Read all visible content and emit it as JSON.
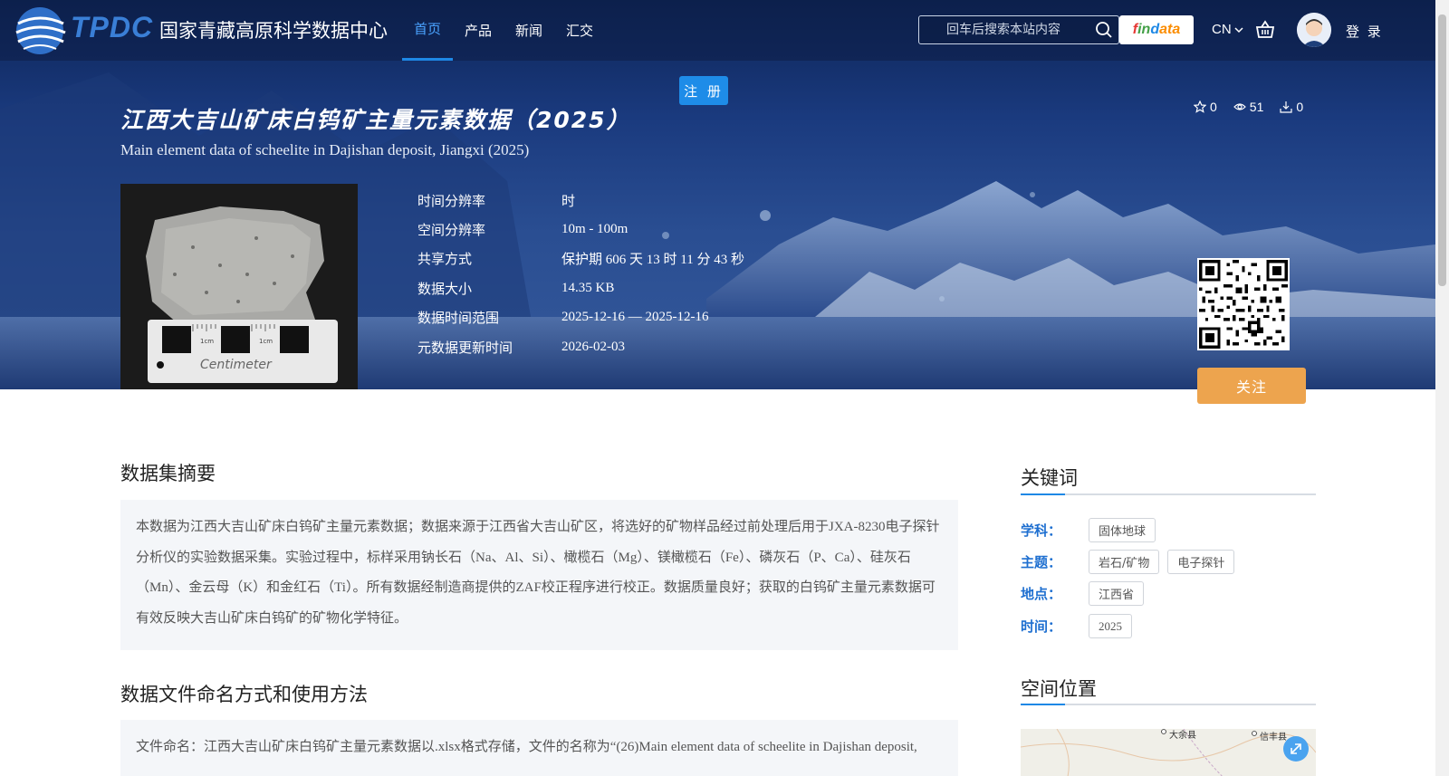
{
  "header": {
    "logo_text": "TPDC",
    "site_name": "国家青藏高原科学数据中心",
    "nav": [
      {
        "label": "首页",
        "active": true
      },
      {
        "label": "产品",
        "active": false
      },
      {
        "label": "新闻",
        "active": false
      },
      {
        "label": "汇交",
        "active": false
      }
    ],
    "search_placeholder": "回车后搜索本站内容",
    "findata_label": "findata",
    "language": "CN",
    "login_label": "登 录"
  },
  "register_label": "注 册",
  "dataset": {
    "title_cn": "江西大吉山矿床白钨矿主量元素数据（2025）",
    "title_en": "Main element data of scheelite in Dajishan deposit, Jiangxi (2025)",
    "stats": {
      "stars": "0",
      "views": "51",
      "downloads": "0"
    },
    "meta": [
      {
        "label": "时间分辨率",
        "value": "时"
      },
      {
        "label": "空间分辨率",
        "value": "10m - 100m"
      },
      {
        "label": "共享方式",
        "value": "保护期 606 天 13 时 11 分 43 秒"
      },
      {
        "label": "数据大小",
        "value": "14.35 KB"
      },
      {
        "label": "数据时间范围",
        "value": "2025-12-16 — 2025-12-16"
      },
      {
        "label": "元数据更新时间",
        "value": "2026-02-03"
      }
    ],
    "thumb_caption": "Centimeter",
    "thumb_tick_label": "1cm",
    "follow_label": "关注"
  },
  "abstract": {
    "title": "数据集摘要",
    "text": "本数据为江西大吉山矿床白钨矿主量元素数据；数据来源于江西省大吉山矿区，将选好的矿物样品经过前处理后用于JXA-8230电子探针分析仪的实验数据采集。实验过程中，标样采用钠长石（Na、Al、Si）、橄榄石（Mg）、镁橄榄石（Fe）、磷灰石（P、Ca）、硅灰石（Mn）、金云母（K）和金红石（Ti）。所有数据经制造商提供的ZAF校正程序进行校正。数据质量良好；获取的白钨矿主量元素数据可有效反映大吉山矿床白钨矿的矿物化学特征。"
  },
  "naming": {
    "title": "数据文件命名方式和使用方法",
    "text": "文件命名：江西大吉山矿床白钨矿主量元素数据以.xlsx格式存储，文件的名称为“(26)Main element data of scheelite in Dajishan deposit,"
  },
  "keywords": {
    "title": "关键词",
    "rows": [
      {
        "label": "学科：",
        "tags": [
          "固体地球"
        ]
      },
      {
        "label": "主题：",
        "tags": [
          "岩石/矿物",
          "电子探针"
        ]
      },
      {
        "label": "地点：",
        "tags": [
          "江西省"
        ]
      },
      {
        "label": "时间：",
        "tags": [
          "2025"
        ]
      }
    ]
  },
  "location": {
    "title": "空间位置",
    "map_labels": [
      "大余县",
      "信丰县"
    ]
  },
  "colors": {
    "accent": "#1e88e5",
    "follow": "#eda44e",
    "keyword_label": "#1e6fd0"
  }
}
